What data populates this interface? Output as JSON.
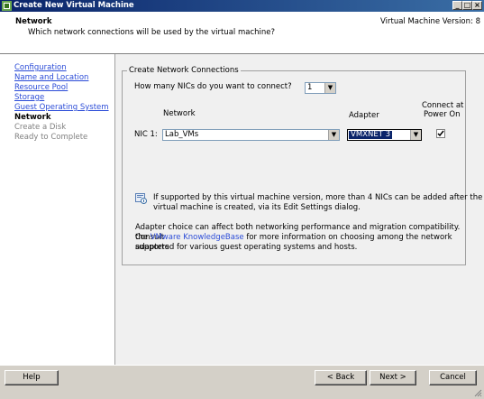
{
  "window": {
    "title": "Create New Virtual Machine",
    "minimize": "_",
    "restore": "□",
    "close": "×"
  },
  "header": {
    "title": "Network",
    "subtitle": "Which network connections will be used by the virtual machine?",
    "version": "Virtual Machine Version: 8"
  },
  "steps": [
    {
      "label": "Configuration",
      "state": "link"
    },
    {
      "label": "Name and Location",
      "state": "link"
    },
    {
      "label": "Resource Pool",
      "state": "link"
    },
    {
      "label": "Storage",
      "state": "link"
    },
    {
      "label": "Guest Operating System",
      "state": "link"
    },
    {
      "label": "Network",
      "state": "current"
    },
    {
      "label": "Create a Disk",
      "state": "pending"
    },
    {
      "label": "Ready to Complete",
      "state": "pending"
    }
  ],
  "group": {
    "title": "Create Network Connections",
    "nic_count_label": "How many NICs do you want to connect?",
    "nic_count_value": "1",
    "col_network": "Network",
    "col_adapter": "Adapter",
    "col_connect_line1": "Connect at",
    "col_connect_line2": "Power On",
    "nic_label": "NIC 1:",
    "network_value": "Lab_VMs",
    "adapter_value": "VMXNET 3",
    "connect_checked": true,
    "info_line1": "If supported by this virtual machine version, more than 4 NICs can be added after the",
    "info_line2": "virtual machine is created, via its Edit Settings dialog.",
    "adapter_line1": "Adapter choice can affect both networking performance and migration compatibility. Consult",
    "adapter_line2_pre": "the ",
    "adapter_link": "VMware KnowledgeBase",
    "adapter_line2_post": " for more information on choosing among the network adapters",
    "adapter_line3": "supported for various guest operating systems and hosts."
  },
  "footer": {
    "help": "Help",
    "back": "< Back",
    "next": "Next >",
    "cancel": "Cancel"
  }
}
